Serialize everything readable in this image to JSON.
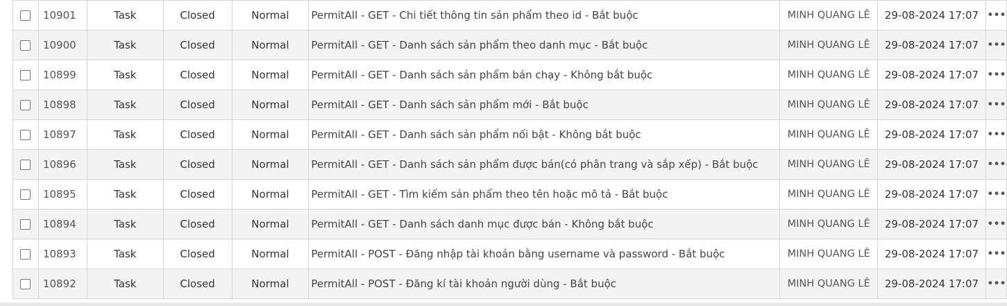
{
  "issues": [
    {
      "id": "10901",
      "tracker": "Task",
      "status": "Closed",
      "priority": "Normal",
      "subject": "PermitAll - GET - Chi tiết thông tin sản phẩm theo id - Bắt buộc",
      "assignee": "MINH QUANG LÊ",
      "updated": "29-08-2024 17:07",
      "menu": "•••"
    },
    {
      "id": "10900",
      "tracker": "Task",
      "status": "Closed",
      "priority": "Normal",
      "subject": "PermitAll - GET - Danh sách sản phẩm theo danh mục - Bắt buộc",
      "assignee": "MINH QUANG LÊ",
      "updated": "29-08-2024 17:07",
      "menu": "•••"
    },
    {
      "id": "10899",
      "tracker": "Task",
      "status": "Closed",
      "priority": "Normal",
      "subject": "PermitAll - GET - Danh sách sản phẩm bán chạy - Không bắt buộc",
      "assignee": "MINH QUANG LÊ",
      "updated": "29-08-2024 17:07",
      "menu": "•••"
    },
    {
      "id": "10898",
      "tracker": "Task",
      "status": "Closed",
      "priority": "Normal",
      "subject": "PermitAll - GET - Danh sách sản phẩm mới - Bắt buộc",
      "assignee": "MINH QUANG LÊ",
      "updated": "29-08-2024 17:07",
      "menu": "•••"
    },
    {
      "id": "10897",
      "tracker": "Task",
      "status": "Closed",
      "priority": "Normal",
      "subject": "PermitAll - GET - Danh sách sản phẩm nối bật - Không bắt buộc",
      "assignee": "MINH QUANG LÊ",
      "updated": "29-08-2024 17:07",
      "menu": "•••"
    },
    {
      "id": "10896",
      "tracker": "Task",
      "status": "Closed",
      "priority": "Normal",
      "subject": "PermitAll - GET - Danh sách sản phẩm được bán(có phân trang và sắp xếp) - Bắt buộc",
      "assignee": "MINH QUANG LÊ",
      "updated": "29-08-2024 17:07",
      "menu": "•••"
    },
    {
      "id": "10895",
      "tracker": "Task",
      "status": "Closed",
      "priority": "Normal",
      "subject": "PermitAll - GET - Tìm kiếm sản phẩm theo tên hoặc mô tả - Bắt buộc",
      "assignee": "MINH QUANG LÊ",
      "updated": "29-08-2024 17:07",
      "menu": "•••"
    },
    {
      "id": "10894",
      "tracker": "Task",
      "status": "Closed",
      "priority": "Normal",
      "subject": "PermitAll - GET - Danh sách danh mục được bán - Không bắt buộc",
      "assignee": "MINH QUANG LÊ",
      "updated": "29-08-2024 17:07",
      "menu": "•••"
    },
    {
      "id": "10893",
      "tracker": "Task",
      "status": "Closed",
      "priority": "Normal",
      "subject": "PermitAll - POST - Đăng nhập tài khoản bằng username và password - Bắt buộc",
      "assignee": "MINH QUANG LÊ",
      "updated": "29-08-2024 17:07",
      "menu": "•••"
    },
    {
      "id": "10892",
      "tracker": "Task",
      "status": "Closed",
      "priority": "Normal",
      "subject": "PermitAll - POST - Đăng kí tài khoản người dùng - Bắt buộc",
      "assignee": "MINH QUANG LÊ",
      "updated": "29-08-2024 17:07",
      "menu": "•••"
    }
  ]
}
